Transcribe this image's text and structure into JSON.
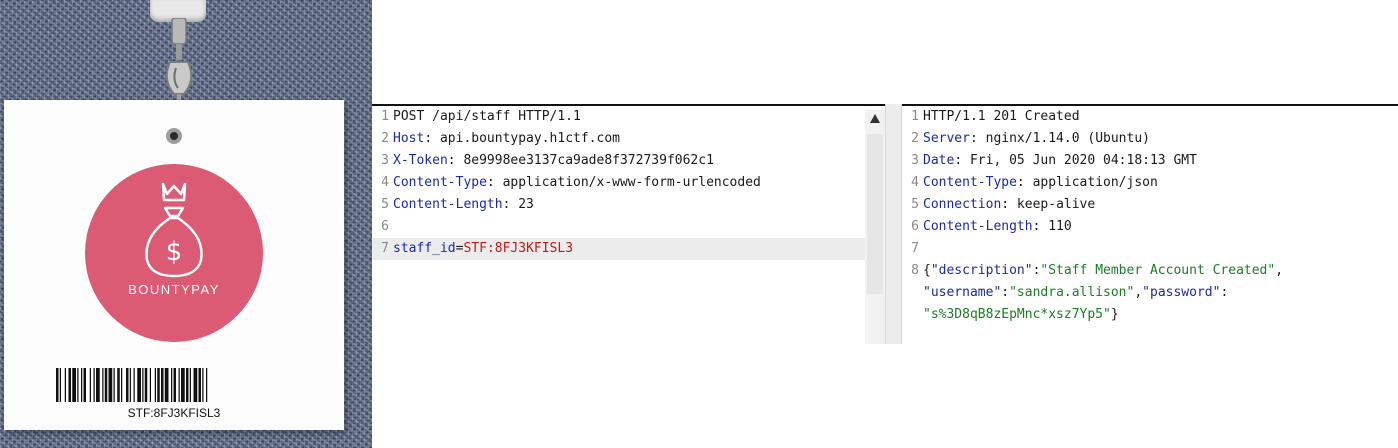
{
  "badge": {
    "brand": "BOUNTYPAY",
    "staff_code": "STF:8FJ3KFISL3"
  },
  "request": {
    "lines": [
      {
        "num": "1",
        "type": "plain",
        "text": "POST /api/staff HTTP/1.1"
      },
      {
        "num": "2",
        "type": "header",
        "name": "Host",
        "value": "api.bountypay.h1ctf.com"
      },
      {
        "num": "3",
        "type": "header",
        "name": "X-Token",
        "value": "8e9998ee3137ca9ade8f372739f062c1"
      },
      {
        "num": "4",
        "type": "header",
        "name": "Content-Type",
        "value": "application/x-www-form-urlencoded"
      },
      {
        "num": "5",
        "type": "header",
        "name": "Content-Length",
        "value": "23"
      },
      {
        "num": "6",
        "type": "blank"
      },
      {
        "num": "7",
        "type": "param",
        "name": "staff_id",
        "value": "STF:8FJ3KFISL3",
        "highlighted": true
      }
    ]
  },
  "response": {
    "lines": [
      {
        "num": "1",
        "type": "plain",
        "text": "HTTP/1.1 201 Created"
      },
      {
        "num": "2",
        "type": "header",
        "name": "Server",
        "value": "nginx/1.14.0 (Ubuntu)"
      },
      {
        "num": "3",
        "type": "header",
        "name": "Date",
        "value": "Fri, 05 Jun 2020 04:18:13 GMT"
      },
      {
        "num": "4",
        "type": "header",
        "name": "Content-Type",
        "value": "application/json"
      },
      {
        "num": "5",
        "type": "header",
        "name": "Connection",
        "value": "keep-alive"
      },
      {
        "num": "6",
        "type": "header",
        "name": "Content-Length",
        "value": "110"
      },
      {
        "num": "7",
        "type": "blank"
      },
      {
        "num": "8",
        "type": "json",
        "segments": [
          {
            "k": "p",
            "t": "{"
          },
          {
            "k": "key",
            "t": "\"description\""
          },
          {
            "k": "p",
            "t": ":"
          },
          {
            "k": "str",
            "t": "\"Staff Member Account Created\""
          },
          {
            "k": "p",
            "t": ","
          }
        ]
      },
      {
        "num": "",
        "type": "json",
        "segments": [
          {
            "k": "key",
            "t": "\"username\""
          },
          {
            "k": "p",
            "t": ":"
          },
          {
            "k": "str",
            "t": "\"sandra.allison\""
          },
          {
            "k": "p",
            "t": ","
          },
          {
            "k": "key",
            "t": "\"password\""
          },
          {
            "k": "p",
            "t": ":"
          }
        ]
      },
      {
        "num": "",
        "type": "json",
        "segments": [
          {
            "k": "str",
            "t": "\"s%3D8qB8zEpMnc*xsz7Yp5\""
          },
          {
            "k": "p",
            "t": "}"
          }
        ]
      }
    ]
  },
  "colors": {
    "header_name": "#1c2b9c",
    "param_value": "#c41a16",
    "json_string": "#1d7b28",
    "logo": "#db5b74"
  }
}
